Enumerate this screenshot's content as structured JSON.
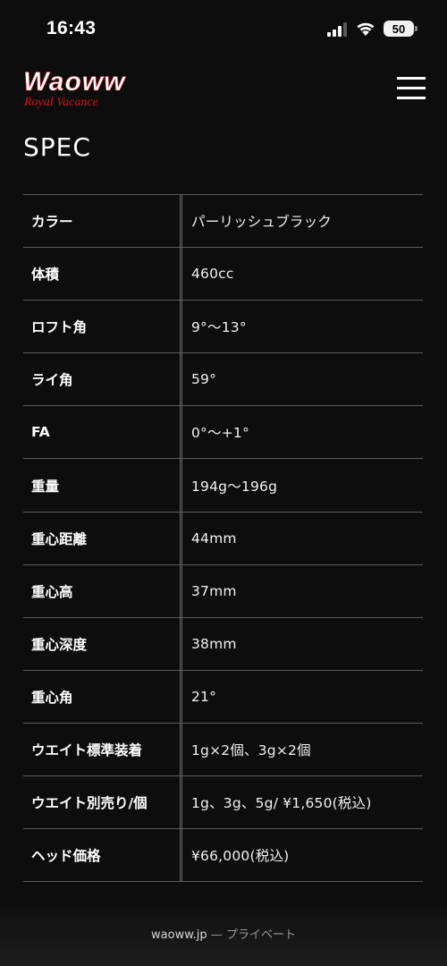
{
  "status_bar": {
    "time": "16:43",
    "battery_level": "50",
    "icons": [
      "signal-icon",
      "wifi-icon",
      "battery-icon"
    ]
  },
  "header": {
    "logo_text": "Waoww",
    "logo_subtext": "Royal Vacance",
    "menu_icon": "hamburger-menu-icon"
  },
  "page_title": "SPEC",
  "spec_rows": [
    {
      "label": "カラー",
      "value": "パーリッシュブラック"
    },
    {
      "label": "体積",
      "value": "460cc"
    },
    {
      "label": "ロフト角",
      "value": "9°〜13°"
    },
    {
      "label": "ライ角",
      "value": "59°"
    },
    {
      "label": "FA",
      "value": "0°〜+1°"
    },
    {
      "label": "重量",
      "value": "194g〜196g"
    },
    {
      "label": "重心距離",
      "value": "44mm"
    },
    {
      "label": "重心高",
      "value": "37mm"
    },
    {
      "label": "重心深度",
      "value": "38mm"
    },
    {
      "label": "重心角",
      "value": "21°"
    },
    {
      "label": "ウエイト標準装着",
      "value": "1g×2個、3g×2個"
    },
    {
      "label": "ウエイト別売り/個",
      "value": "1g、3g、5g/ ¥1,650(税込)"
    },
    {
      "label": "ヘッド価格",
      "value": "¥66,000(税込)"
    }
  ],
  "browser_bar": {
    "domain": "waoww.jp",
    "separator": " — ",
    "mode": "プライベート"
  },
  "colors": {
    "background": "#0d0d0d",
    "logo_red": "#d0141c",
    "divider": "#5a5a5a"
  }
}
